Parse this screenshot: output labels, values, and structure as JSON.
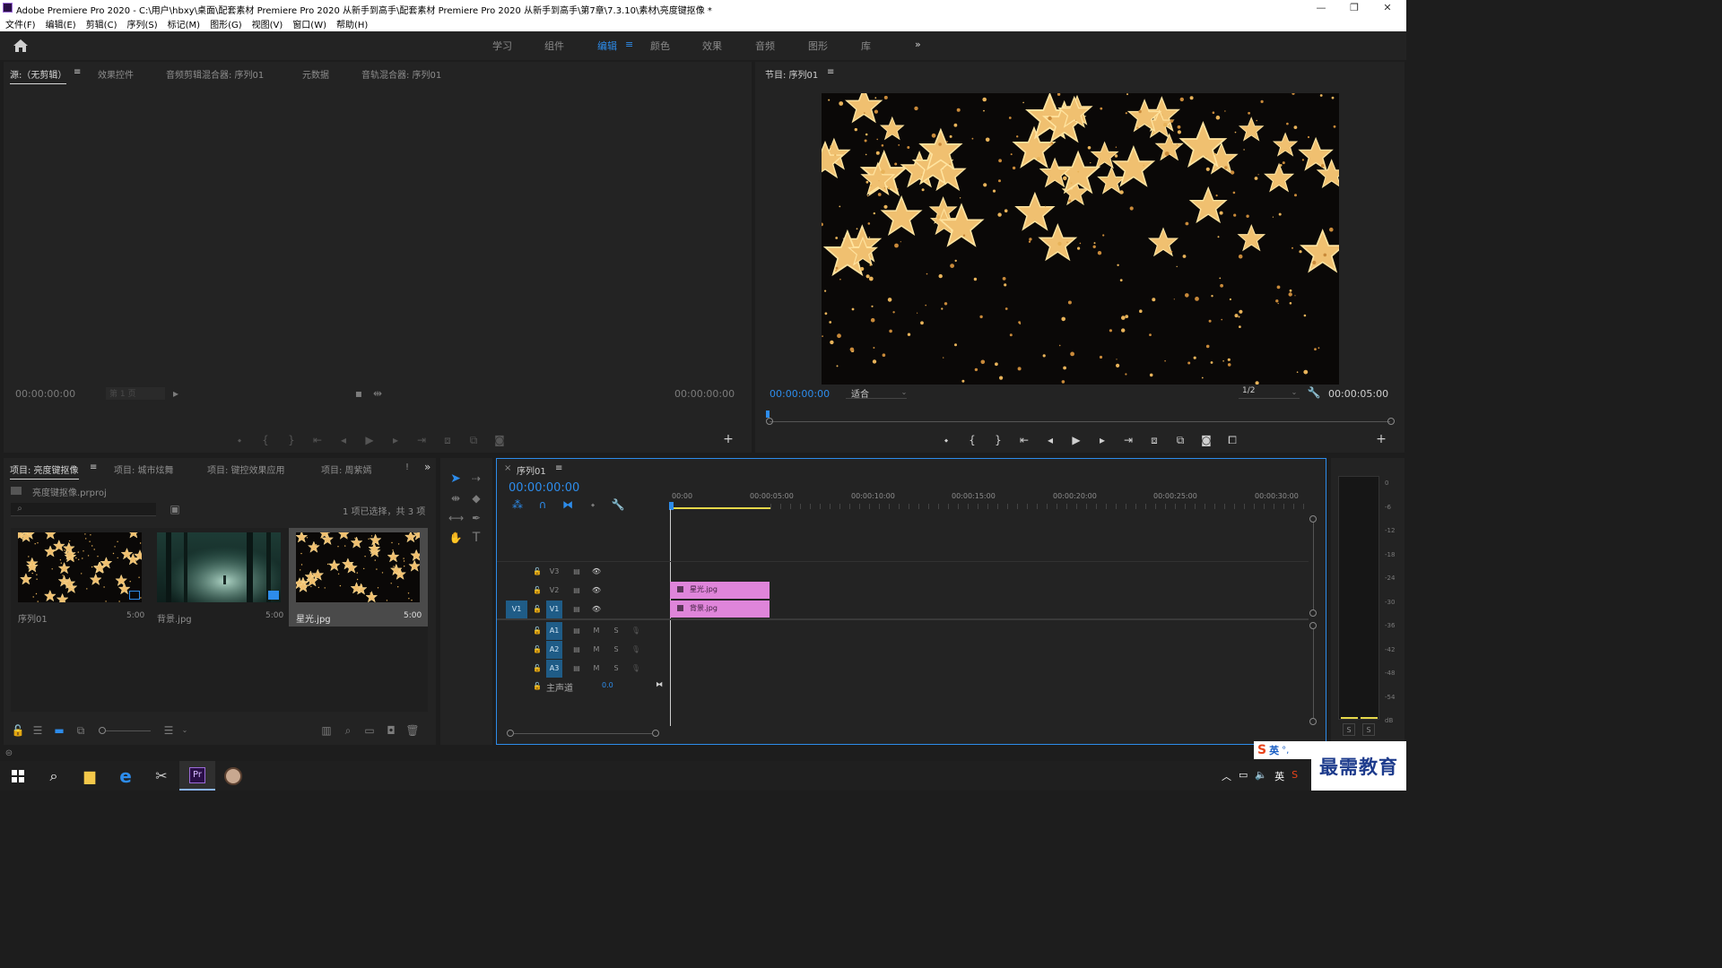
{
  "app": {
    "title": "Adobe Premiere Pro 2020 - C:\\用户\\hbxy\\桌面\\配套素材 Premiere Pro 2020 从新手到高手\\配套素材 Premiere Pro 2020 从新手到高手\\第7章\\7.3.10\\素材\\亮度键抠像 *",
    "icon": "Pr",
    "window_controls": [
      "—",
      "❐",
      "✕"
    ]
  },
  "menu": [
    "文件(F)",
    "编辑(E)",
    "剪辑(C)",
    "序列(S)",
    "标记(M)",
    "图形(G)",
    "视图(V)",
    "窗口(W)",
    "帮助(H)"
  ],
  "workspaces": {
    "items": [
      "学习",
      "组件",
      "编辑",
      "颜色",
      "效果",
      "音频",
      "图形",
      "库"
    ],
    "active": "编辑",
    "more": "»",
    "active_menu": "≡"
  },
  "source_panel": {
    "tabs": [
      "源:（无剪辑）",
      "效果控件",
      "音频剪辑混合器: 序列01",
      "元数据",
      "音轨混合器: 序列01"
    ],
    "tab_menu": "≡",
    "timecode_left": "00:00:00:00",
    "page_dropdown": "第 1 页",
    "timecode_right": "00:00:00:00",
    "add": "+"
  },
  "program_panel": {
    "tab": "节目: 序列01",
    "tab_menu": "≡",
    "timecode": "00:00:00:00",
    "fit": "适合",
    "resolution": "1/2",
    "duration": "00:00:05:00",
    "add": "+"
  },
  "project_panel": {
    "tabs": [
      "项目: 亮度键抠像",
      "项目: 城市炫舞",
      "项目: 键控效果应用",
      "项目: 周紫嫣"
    ],
    "tab_menu": "≡",
    "tab_more": "»",
    "tab_excl": "!",
    "file": "亮度键抠像.prproj",
    "search_placeholder": "",
    "selection_info": "1 项已选择，共 3 项",
    "items": [
      {
        "name": "序列01",
        "duration": "5:00",
        "thumb": "stars"
      },
      {
        "name": "背景.jpg",
        "duration": "5:00",
        "thumb": "forest"
      },
      {
        "name": "星光.jpg",
        "duration": "5:00",
        "thumb": "stars",
        "selected": true
      }
    ]
  },
  "timeline": {
    "close": "×",
    "tab": "序列01",
    "tab_menu": "≡",
    "timecode": "00:00:00:00",
    "ruler": [
      "00:00",
      "00:00:05:00",
      "00:00:10:00",
      "00:00:15:00",
      "00:00:20:00",
      "00:00:25:00",
      "00:00:30:00"
    ],
    "video_tracks": [
      {
        "id": "V3",
        "source": ""
      },
      {
        "id": "V2",
        "source": ""
      },
      {
        "id": "V1",
        "source": "V1"
      }
    ],
    "audio_tracks": [
      {
        "id": "A1",
        "m": "M",
        "s": "S"
      },
      {
        "id": "A2",
        "m": "M",
        "s": "S"
      },
      {
        "id": "A3",
        "m": "M",
        "s": "S"
      }
    ],
    "master": {
      "label": "主声道",
      "value": "0.0"
    },
    "clips": [
      {
        "track": "V2",
        "name": "星光.jpg",
        "color": "#df85da"
      },
      {
        "track": "V1",
        "name": "背景.jpg",
        "color": "#df85da"
      }
    ]
  },
  "audio_meter": {
    "labels": [
      "0",
      "-6",
      "-12",
      "-18",
      "-24",
      "-30",
      "-36",
      "-42",
      "-48",
      "-54",
      "dB"
    ],
    "solo": [
      "S",
      "S"
    ]
  },
  "ime": {
    "badge": "英"
  },
  "watermark": "最需教育",
  "colors": {
    "accent": "#2d8ceb",
    "clip": "#df85da",
    "panel": "#232323",
    "background": "#1d1d1d"
  }
}
